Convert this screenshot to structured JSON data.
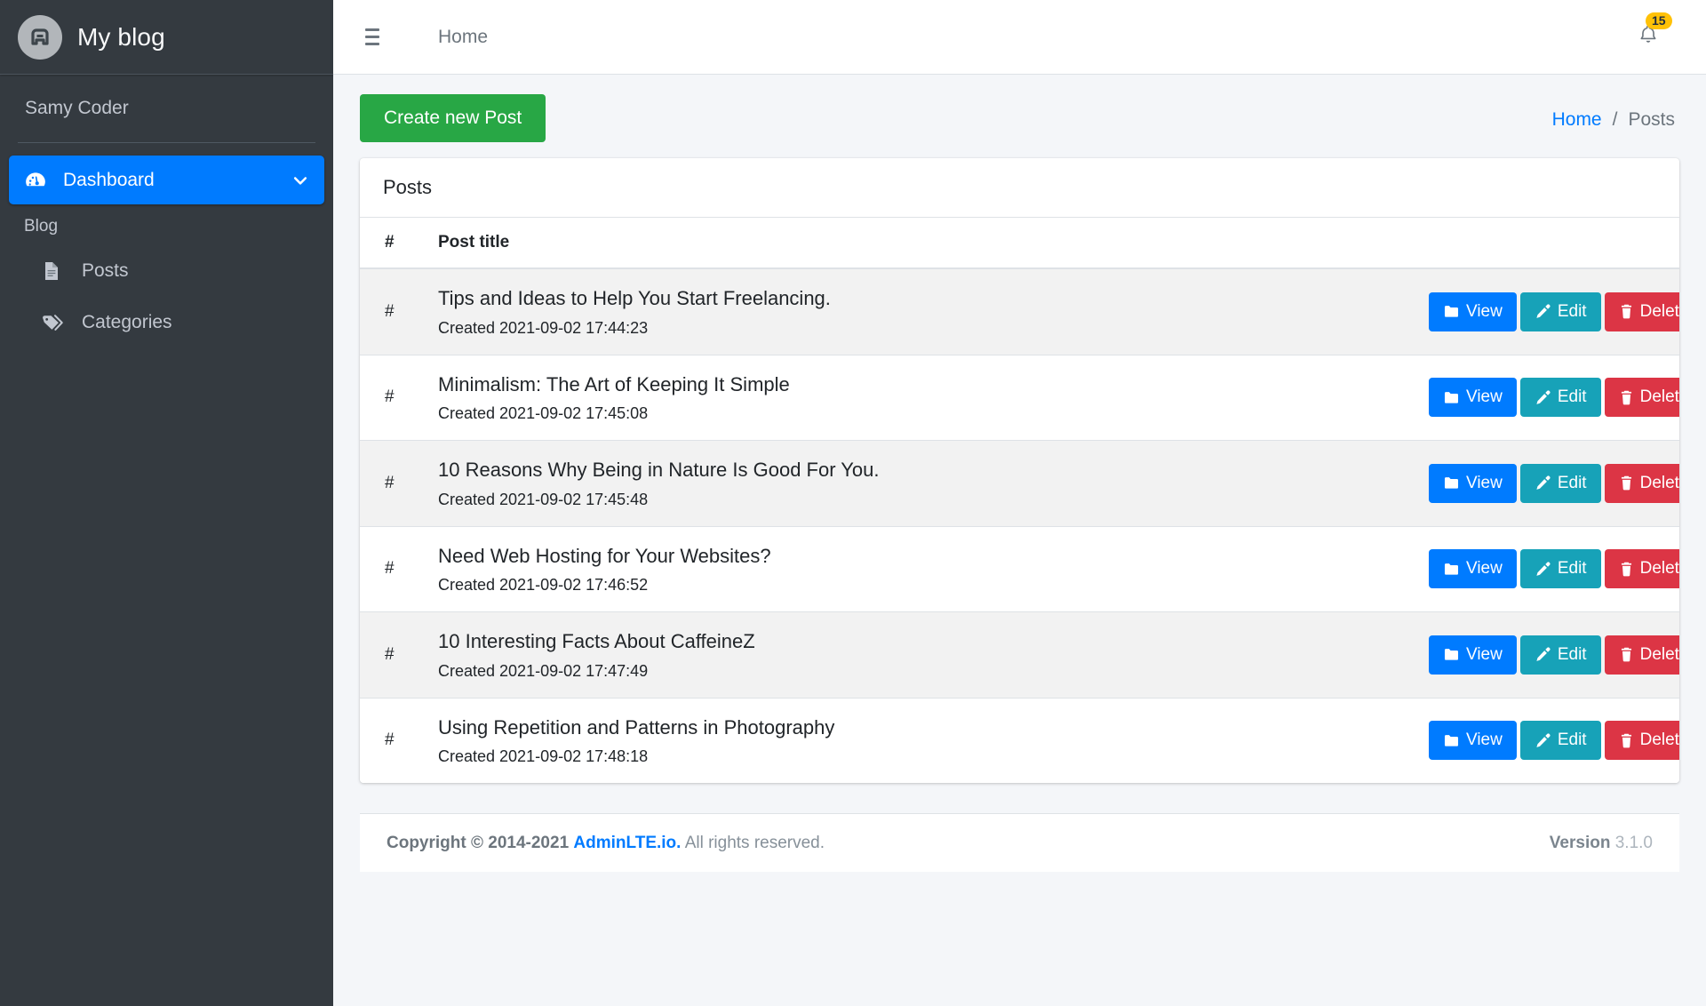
{
  "sidebar": {
    "brand": {
      "title": "My blog",
      "logo_icon": "circle-a-logo-icon"
    },
    "user": {
      "name": "Samy Coder"
    },
    "nav": {
      "dashboard": {
        "label": "Dashboard",
        "icon": "tachometer-icon",
        "arrow_icon": "chevron-down-icon",
        "active": true
      },
      "section_header": "Blog",
      "items": [
        {
          "label": "Posts",
          "icon": "file-lines-icon"
        },
        {
          "label": "Categories",
          "icon": "tags-icon"
        }
      ]
    }
  },
  "navbar": {
    "menu_icon": "hamburger-icon",
    "home_link": "Home",
    "bell_icon": "bell-icon",
    "notification_count": "15"
  },
  "content_header": {
    "create_button": "Create new Post",
    "breadcrumb": {
      "home": "Home",
      "separator": "/",
      "current": "Posts"
    }
  },
  "card": {
    "title": "Posts",
    "columns": {
      "hash": "#",
      "title": "Post title",
      "actions": ""
    },
    "actions": {
      "view": {
        "label": "View",
        "icon": "folder-icon",
        "color": "#007bff"
      },
      "edit": {
        "label": "Edit",
        "icon": "pencil-icon",
        "color": "#17a2b8"
      },
      "delete": {
        "label": "Delete",
        "icon": "trash-icon",
        "color": "#dc3545"
      }
    },
    "rows": [
      {
        "hash": "#",
        "title": "Tips and Ideas to Help You Start Freelancing.",
        "meta": "Created 2021-09-02 17:44:23"
      },
      {
        "hash": "#",
        "title": "Minimalism: The Art of Keeping It Simple",
        "meta": "Created 2021-09-02 17:45:08"
      },
      {
        "hash": "#",
        "title": "10 Reasons Why Being in Nature Is Good For You.",
        "meta": "Created 2021-09-02 17:45:48"
      },
      {
        "hash": "#",
        "title": "Need Web Hosting for Your Websites?",
        "meta": "Created 2021-09-02 17:46:52"
      },
      {
        "hash": "#",
        "title": "10 Interesting Facts About CaffeineZ",
        "meta": "Created 2021-09-02 17:47:49"
      },
      {
        "hash": "#",
        "title": "Using Repetition and Patterns in Photography",
        "meta": "Created 2021-09-02 17:48:18"
      }
    ]
  },
  "footer": {
    "copyright_strong": "Copyright © 2014-2021",
    "brand_link": "AdminLTE.io.",
    "rights": "All rights reserved.",
    "version_label": "Version",
    "version_number": "3.1.0"
  },
  "colors": {
    "sidebar_bg": "#343a40",
    "accent_blue": "#007bff",
    "success_green": "#28a745",
    "teal": "#17a2b8",
    "danger_red": "#dc3545",
    "badge_yellow": "#ffc107",
    "content_bg": "#f4f6f9"
  }
}
